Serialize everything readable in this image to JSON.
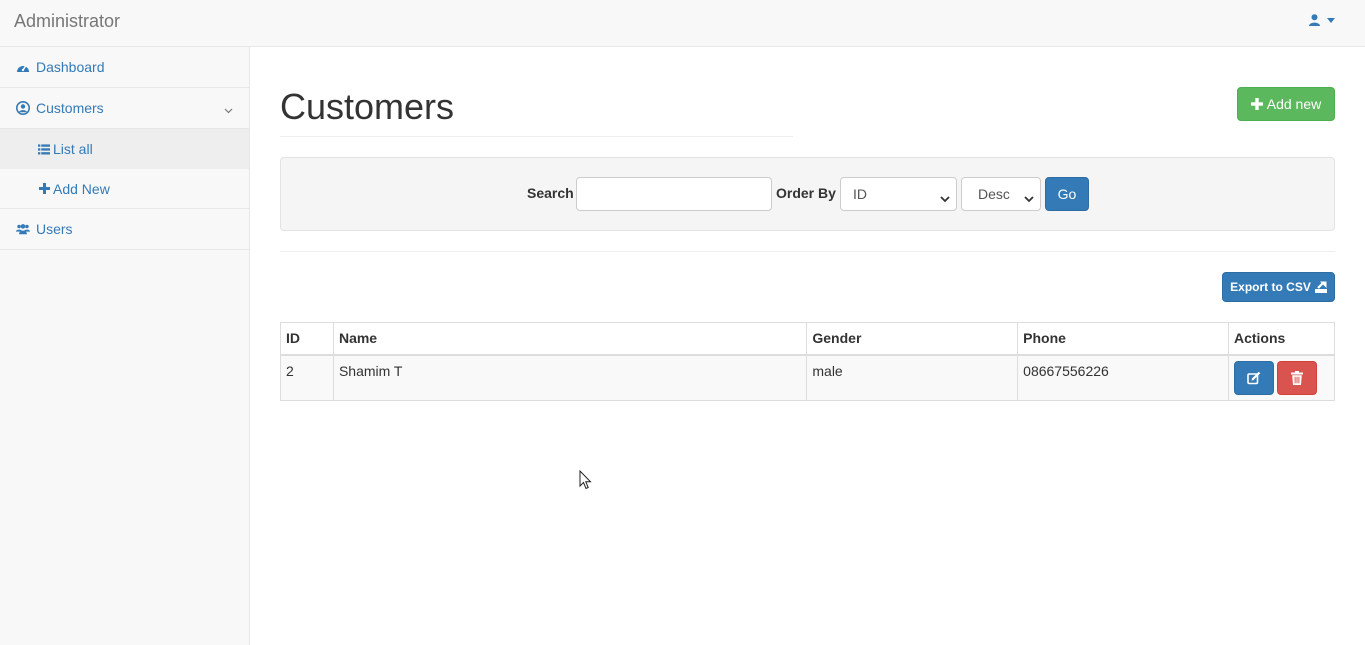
{
  "app": {
    "brand": "Administrator"
  },
  "sidebar": {
    "items": [
      {
        "label": "Dashboard",
        "icon": "dashboard-icon"
      },
      {
        "label": "Customers",
        "icon": "user-circle-icon",
        "expanded": true,
        "children": [
          {
            "label": "List all",
            "icon": "list-icon",
            "active": true
          },
          {
            "label": "Add New",
            "icon": "plus-icon"
          }
        ]
      },
      {
        "label": "Users",
        "icon": "users-icon"
      }
    ]
  },
  "main": {
    "title": "Customers",
    "add_button": "Add new",
    "search": {
      "label": "Search",
      "value": "",
      "placeholder": ""
    },
    "order_by": {
      "label": "Order By",
      "selected": "ID"
    },
    "order_dir": {
      "selected": "Desc"
    },
    "go_button": "Go",
    "export_button": "Export to CSV",
    "table": {
      "columns": [
        "ID",
        "Name",
        "Gender",
        "Phone",
        "Actions"
      ],
      "rows": [
        {
          "id": "2",
          "name": "Shamim T",
          "gender": "male",
          "phone": "08667556226"
        }
      ]
    }
  },
  "colors": {
    "primary": "#337ab7",
    "success": "#5cb85c",
    "danger": "#d9534f",
    "sidebar_bg": "#f8f8f8"
  }
}
